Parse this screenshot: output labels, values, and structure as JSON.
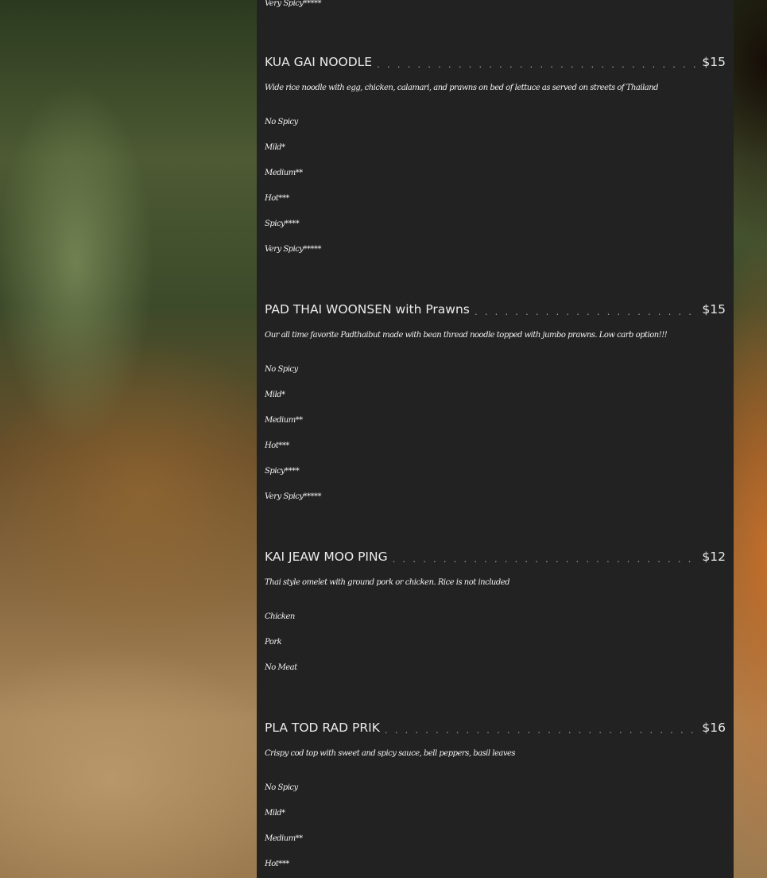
{
  "top_option": "Very Spicy*****",
  "dot_leader": ". . . . . . . . . . . . . . . . . . . . . . . . . . . . . . . . . . . . . . . . . . . . . . . . . . . . . . . . . . . . . . . . . . . . . . . . . . . . . . . . . . . . . . . . . . . . . . . .",
  "items": [
    {
      "name": "KUA GAI NOODLE",
      "price": "$15",
      "description": "Wide rice noodle with egg, chicken, calamari, and prawns on bed of lettuce as served on streets of Thailand",
      "options": [
        "No Spicy",
        "Mild*",
        "Medium**",
        "Hot***",
        "Spicy****",
        "Very Spicy*****"
      ]
    },
    {
      "name": "PAD THAI WOONSEN with Prawns",
      "price": "$15",
      "description": "Our all time favorite Padthaibut made with bean thread noodle topped with jumbo prawns. Low carb option!!!",
      "options": [
        "No Spicy",
        "Mild*",
        "Medium**",
        "Hot***",
        "Spicy****",
        "Very Spicy*****"
      ]
    },
    {
      "name": "KAI JEAW MOO PING",
      "price": "$12",
      "description": "Thai style omelet with ground pork or chicken. Rice is not included",
      "options": [
        "Chicken",
        "Pork",
        "No Meat"
      ]
    },
    {
      "name": "PLA TOD RAD PRIK",
      "price": "$16",
      "description": "Crispy cod top with sweet and spicy sauce, bell peppers, basil leaves",
      "options": [
        "No Spicy",
        "Mild*",
        "Medium**",
        "Hot***"
      ]
    }
  ]
}
